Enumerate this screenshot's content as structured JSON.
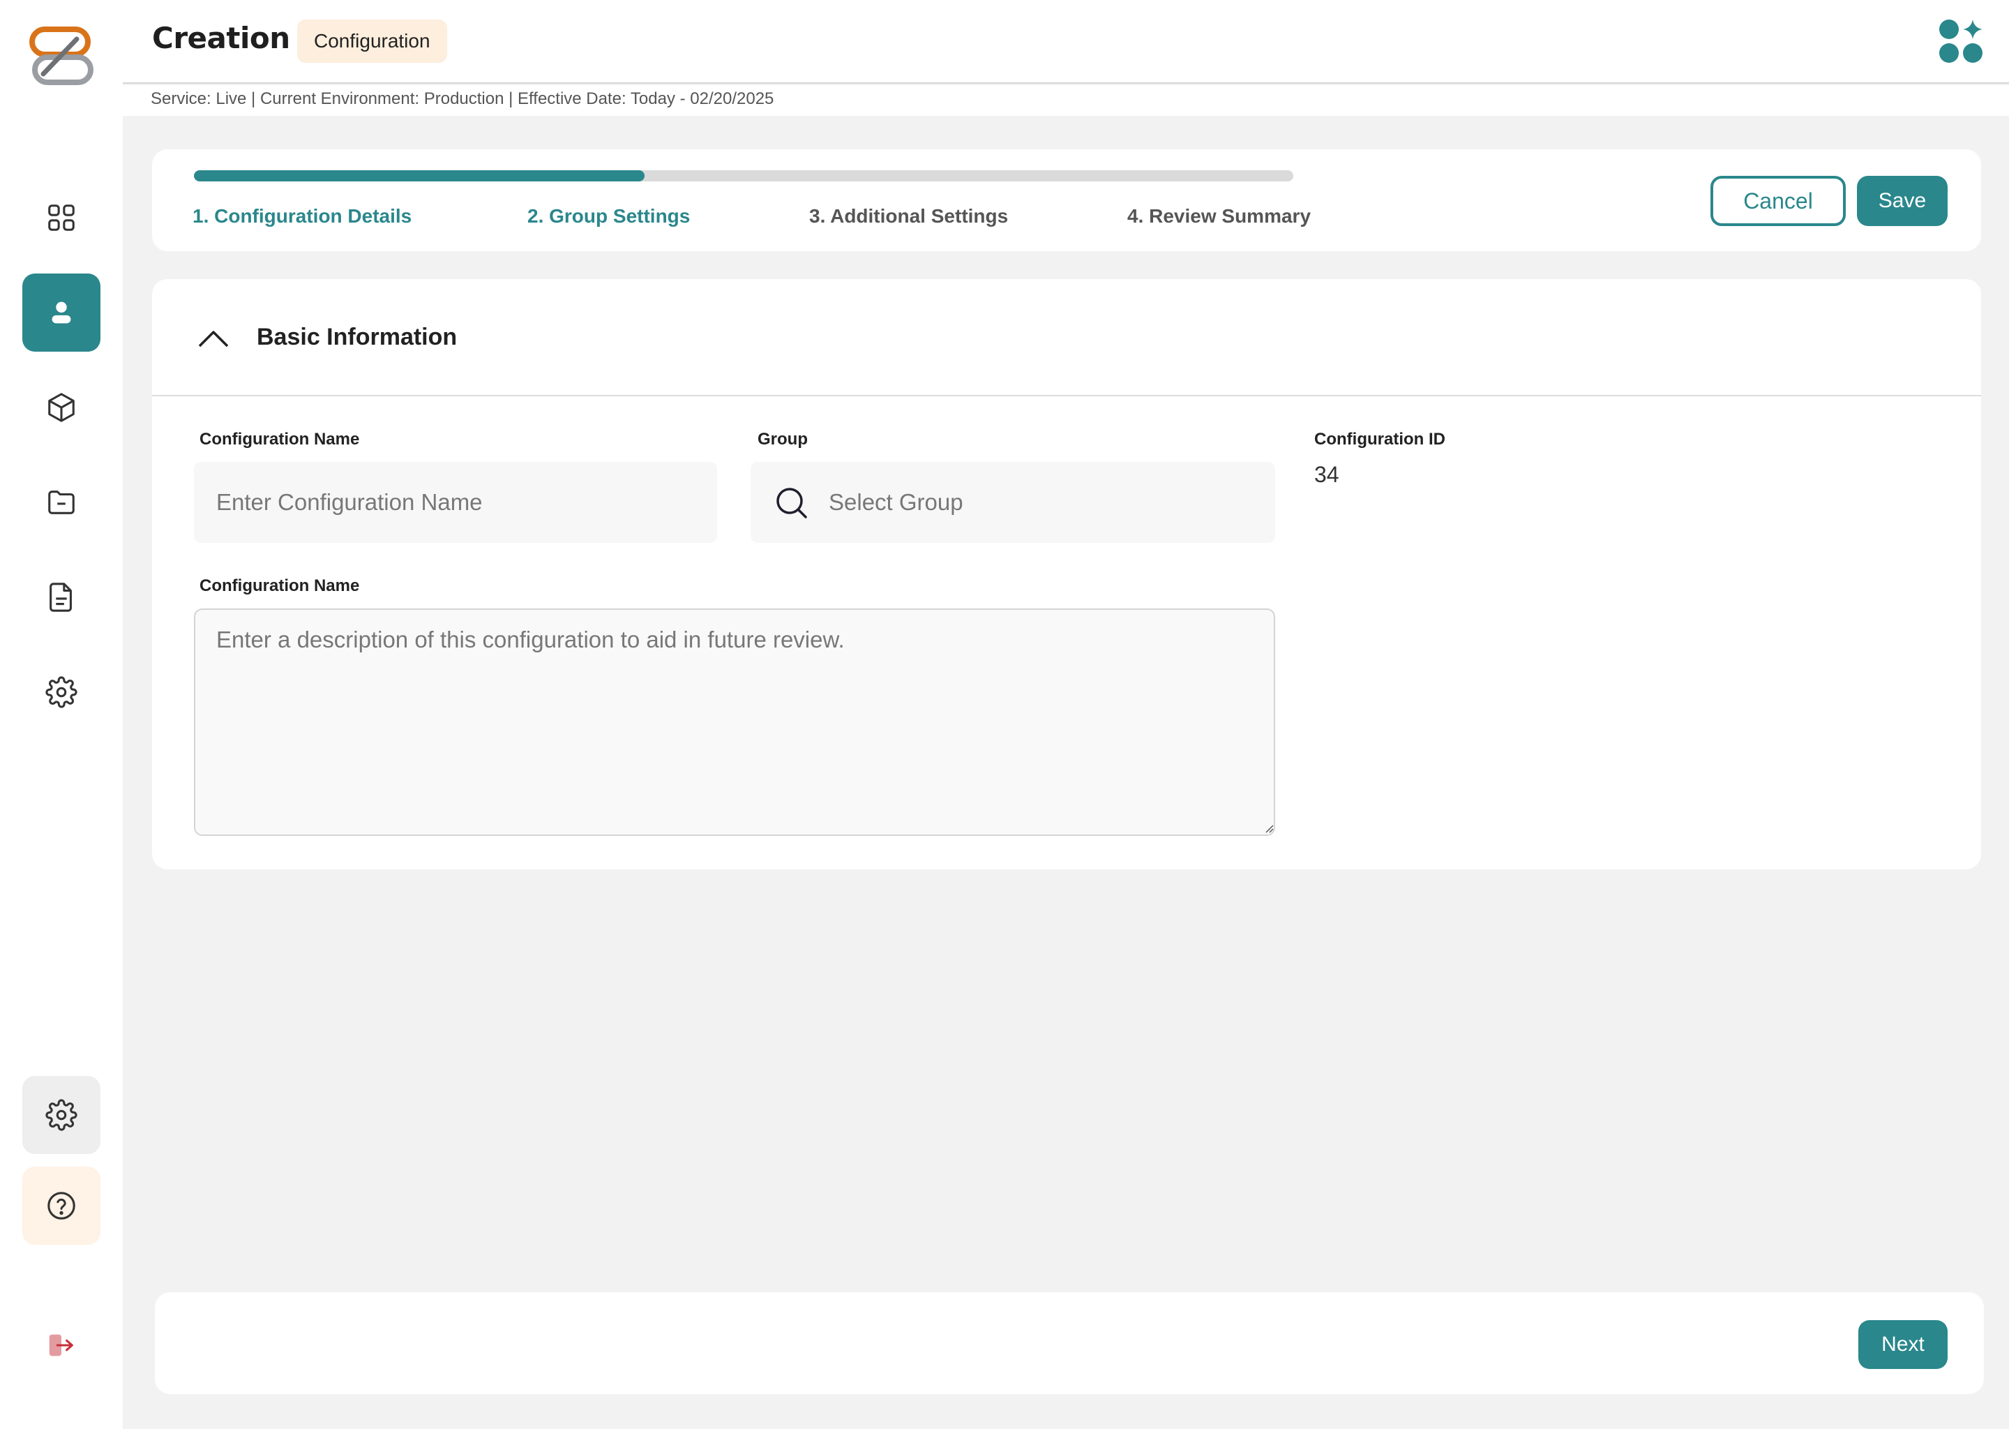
{
  "header": {
    "title": "Creation",
    "badge": "Configuration",
    "status_line": "Service: Live | Current Environment: Production | Effective Date: Today - 02/20/2025"
  },
  "sidebar": {
    "items": [
      {
        "name": "dashboard",
        "icon": "grid-icon"
      },
      {
        "name": "users",
        "icon": "user-icon",
        "active": true
      },
      {
        "name": "packages",
        "icon": "box-icon"
      },
      {
        "name": "folders",
        "icon": "folder-icon"
      },
      {
        "name": "documents",
        "icon": "document-icon"
      },
      {
        "name": "settings",
        "icon": "gear-icon"
      }
    ],
    "bottom": [
      {
        "name": "admin-settings",
        "icon": "gear-icon"
      },
      {
        "name": "help",
        "icon": "help-icon"
      },
      {
        "name": "logout",
        "icon": "logout-icon"
      }
    ]
  },
  "stepper": {
    "progress": 0.41,
    "steps": [
      {
        "label": "1. Configuration Details",
        "state": "done"
      },
      {
        "label": "2. Group Settings",
        "state": "done"
      },
      {
        "label": "3. Additional Settings",
        "state": "pending"
      },
      {
        "label": "4. Review Summary",
        "state": "pending"
      }
    ],
    "cancel_label": "Cancel",
    "save_label": "Save"
  },
  "section": {
    "title": "Basic Information",
    "fields": {
      "config_name_label": "Configuration Name",
      "config_name_placeholder": "Enter Configuration Name",
      "group_label": "Group",
      "group_placeholder": "Select Group",
      "config_id_label": "Configuration ID",
      "config_id_value": "34",
      "description_label": "Configuration Name",
      "description_placeholder": "Enter a description of this configuration to aid in future review."
    }
  },
  "footer": {
    "next_label": "Next"
  },
  "colors": {
    "accent": "#2a878c",
    "badge_bg": "#fdeedd",
    "logo_orange": "#d9731a",
    "logo_gray": "#9a9ea3",
    "logout_red": "#d9474f"
  }
}
